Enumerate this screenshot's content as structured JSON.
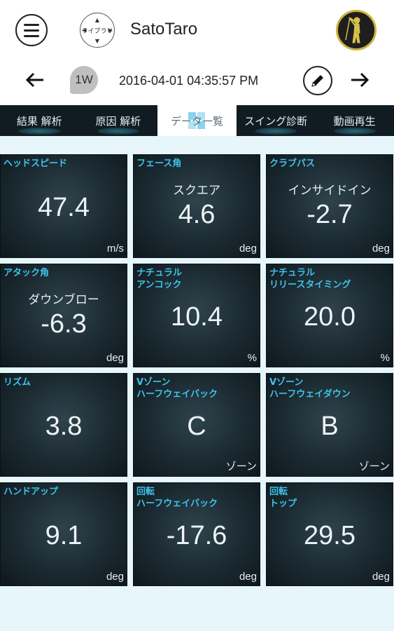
{
  "header": {
    "library_label": "ライブラリ",
    "username": "SatoTaro",
    "club": "1W",
    "datetime": "2016-04-01 04:35:57 PM"
  },
  "tabs": [
    {
      "label": "結果 解析",
      "active": false
    },
    {
      "label": "原因 解析",
      "active": false
    },
    {
      "label": "データ一覧",
      "active": true
    },
    {
      "label": "スイング診断",
      "active": false
    },
    {
      "label": "動画再生",
      "active": false
    }
  ],
  "tiles": [
    {
      "title": "ヘッドスピード",
      "sub": "",
      "value": "47.4",
      "unit": "m/s"
    },
    {
      "title": "フェース角",
      "sub": "スクエア",
      "value": "4.6",
      "unit": "deg"
    },
    {
      "title": "クラブパス",
      "sub": "インサイドイン",
      "value": "-2.7",
      "unit": "deg"
    },
    {
      "title": "アタック角",
      "sub": "ダウンブロー",
      "value": "-6.3",
      "unit": "deg"
    },
    {
      "title": "ナチュラル\nアンコック",
      "sub": "",
      "value": "10.4",
      "unit": "%"
    },
    {
      "title": "ナチュラル\nリリースタイミング",
      "sub": "",
      "value": "20.0",
      "unit": "%"
    },
    {
      "title": "リズム",
      "sub": "",
      "value": "3.8",
      "unit": ""
    },
    {
      "title": "Vゾーン\nハーフウェイバック",
      "sub": "",
      "value": "C",
      "unit": "ゾーン"
    },
    {
      "title": "Vゾーン\nハーフウェイダウン",
      "sub": "",
      "value": "B",
      "unit": "ゾーン"
    },
    {
      "title": "ハンドアップ",
      "sub": "",
      "value": "9.1",
      "unit": "deg"
    },
    {
      "title": "回転\nハーフウェイバック",
      "sub": "",
      "value": "-17.6",
      "unit": "deg"
    },
    {
      "title": "回転\nトップ",
      "sub": "",
      "value": "29.5",
      "unit": "deg"
    }
  ],
  "colors": {
    "accent": "#3fc3ea",
    "tab_bar": "#101c22",
    "grid_bg": "#e6f6fb",
    "avatar_ring": "#c9b53c"
  },
  "icons": {
    "menu": "hamburger-menu-icon",
    "library": "library-dial-icon",
    "avatar": "golfer-avatar-icon",
    "prev": "arrow-left-icon",
    "next": "arrow-right-icon",
    "club": "club-badge-icon",
    "edit": "pencil-icon"
  }
}
